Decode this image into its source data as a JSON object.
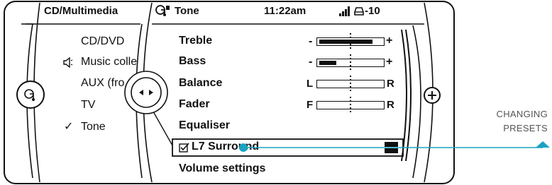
{
  "colors": {
    "accent": "#1aa3c2",
    "ink": "#111111",
    "caption": "#555555"
  },
  "left_panel": {
    "title": "CD/Multimedia",
    "items": [
      {
        "label": "CD/DVD",
        "icon": null
      },
      {
        "label": "Music colle",
        "icon": "speaker-icon"
      },
      {
        "label": "AUX (fro",
        "icon": null
      },
      {
        "label": "TV",
        "icon": null
      },
      {
        "label": "Tone",
        "icon": "checkmark-icon"
      }
    ]
  },
  "right_panel": {
    "title": "Tone",
    "time": "11:22am",
    "temperature": "-10",
    "settings": [
      {
        "label": "Treble",
        "left": "-",
        "right": "+",
        "level": 0.85
      },
      {
        "label": "Bass",
        "left": "-",
        "right": "+",
        "level": 0.27
      },
      {
        "label": "Balance",
        "left": "L",
        "right": "R"
      },
      {
        "label": "Fader",
        "left": "F",
        "right": "R"
      },
      {
        "label": "Equaliser"
      },
      {
        "label": "L7 Surround"
      },
      {
        "label": "Volume settings"
      }
    ]
  },
  "annotation": {
    "line1": "CHANGING",
    "line2": "PRESETS"
  }
}
